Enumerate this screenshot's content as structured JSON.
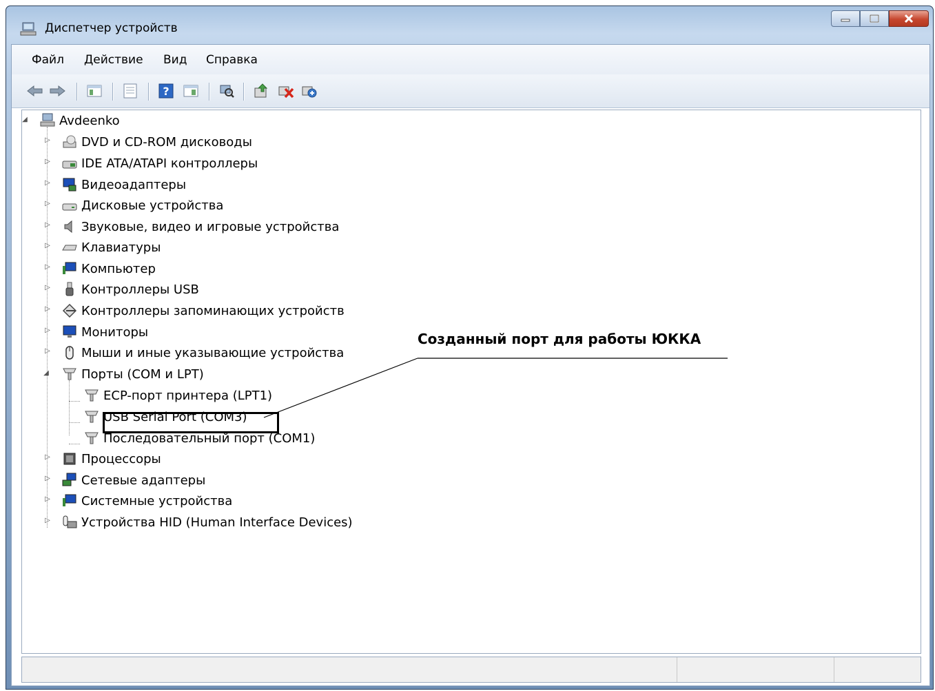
{
  "window": {
    "title": "Диспетчер устройств"
  },
  "menu": [
    "Файл",
    "Действие",
    "Вид",
    "Справка"
  ],
  "toolbar": {
    "buttons": [
      "back-icon",
      "forward-icon",
      "show-hide-console-tree-icon",
      "properties-icon",
      "help-icon",
      "view-icon",
      "scan-hardware-icon",
      "update-driver-icon",
      "uninstall-icon",
      "enable-device-icon"
    ]
  },
  "tree": {
    "root": "Avdeenko",
    "categories": [
      "DVD и CD-ROM дисководы",
      "IDE ATA/ATAPI контроллеры",
      "Видеоадаптеры",
      "Дисковые устройства",
      "Звуковые, видео и игровые устройства",
      "Клавиатуры",
      "Компьютер",
      "Контроллеры USB",
      "Контроллеры запоминающих устройств",
      "Мониторы",
      "Мыши и иные указывающие устройства",
      "Порты (COM и LPT)",
      "Процессоры",
      "Сетевые адаптеры",
      "Системные устройства",
      "Устройства HID (Human Interface Devices)"
    ],
    "ports_children": [
      "ECP-порт принтера (LPT1)",
      "USB Serial Port (COM3)",
      "Последовательный порт (COM1)"
    ]
  },
  "annotation": {
    "text": "Созданный порт для работы ЮККА"
  },
  "colors": {
    "accent": "#1f5fbf",
    "close": "#c6462e"
  }
}
